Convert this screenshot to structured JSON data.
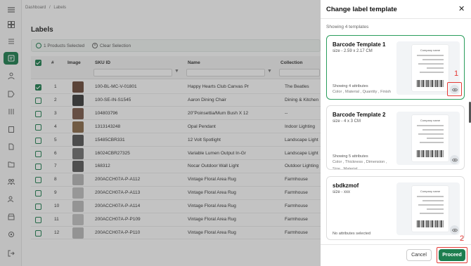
{
  "breadcrumb": {
    "root": "Dashboard",
    "sep": "/",
    "current": "Labels"
  },
  "page_title": "Labels",
  "selection": {
    "count_text": "1 Products Selected",
    "clear_label": "Clear Selection"
  },
  "table": {
    "headers": {
      "num": "#",
      "image": "Image",
      "sku": "SKU ID",
      "name": "Name",
      "collection": "Collection"
    },
    "rows": [
      {
        "num": "1",
        "sku": "100-BL-MC-V-01801",
        "name": "Happy Hearts Club Canvas Pr",
        "collection": "The Beatles",
        "checked": true
      },
      {
        "num": "2",
        "sku": "100-SE-IN-S1545",
        "name": "Aaron Dining Chair",
        "collection": "Dining & Kitchen",
        "checked": false
      },
      {
        "num": "3",
        "sku": "104803796",
        "name": "20\"Poinsettia/Mum Bush X 12",
        "collection": "--",
        "checked": false
      },
      {
        "num": "4",
        "sku": "1313143248",
        "name": "Opal Pendant",
        "collection": "Indoor Lighting",
        "checked": false
      },
      {
        "num": "5",
        "sku": "15485CBR331",
        "name": "12 Volt Spotlight",
        "collection": "Landscape Light",
        "checked": false
      },
      {
        "num": "6",
        "sku": "16024CBR27325",
        "name": "Variable Lumen Output In-Gr",
        "collection": "Landscape Light",
        "checked": false
      },
      {
        "num": "7",
        "sku": "168312",
        "name": "Nocar Outdoor Wall Light",
        "collection": "Outdoor Lighting",
        "checked": false
      },
      {
        "num": "8",
        "sku": "200ACCH07A-P-A112",
        "name": "Vintage Floral Area Rug",
        "collection": "Farmhouse",
        "checked": false
      },
      {
        "num": "9",
        "sku": "200ACCH07A-P-A113",
        "name": "Vintage Floral Area Rug",
        "collection": "Farmhouse",
        "checked": false
      },
      {
        "num": "10",
        "sku": "200ACCH07A-P-A114",
        "name": "Vintage Floral Area Rug",
        "collection": "Farmhouse",
        "checked": false
      },
      {
        "num": "11",
        "sku": "200ACCH07A-P-P109",
        "name": "Vintage Floral Area Rug",
        "collection": "Farmhouse",
        "checked": false
      },
      {
        "num": "12",
        "sku": "200ACCH07A-P-P110",
        "name": "Vintage Floral Area Rug",
        "collection": "Farmhouse",
        "checked": false
      }
    ]
  },
  "panel": {
    "title": "Change label template",
    "showing": "Showing 4 templates",
    "templates": [
      {
        "name": "Barcode Template 1",
        "size": "size - 2.59 x 2.17 CM",
        "attr_count": "Showing 4 attributes",
        "attr_line1": "Color  ,  Material  ,  Quantity  ,  Finish",
        "attr_line2": "",
        "selected": true
      },
      {
        "name": "Barcode Template 2",
        "size": "size - 4 x 3 CM",
        "attr_count": "Showing 5 attributes",
        "attr_line1": "Color  ,  Thickness  ,  Dimension  ,",
        "attr_line2": "Size  ,  Material",
        "selected": false
      },
      {
        "name": "sbdkzmof",
        "size": "size - xxx",
        "attr_count": "No attributes selected",
        "attr_line1": "",
        "attr_line2": "",
        "selected": false
      }
    ],
    "preview_company": "Company name",
    "cancel_label": "Cancel",
    "proceed_label": "Proceed",
    "annotation_1": "1",
    "annotation_2": "2"
  },
  "colors": {
    "accent": "#1e7e4f",
    "annotation": "#e53935",
    "selected_border": "#2a9d5c"
  }
}
